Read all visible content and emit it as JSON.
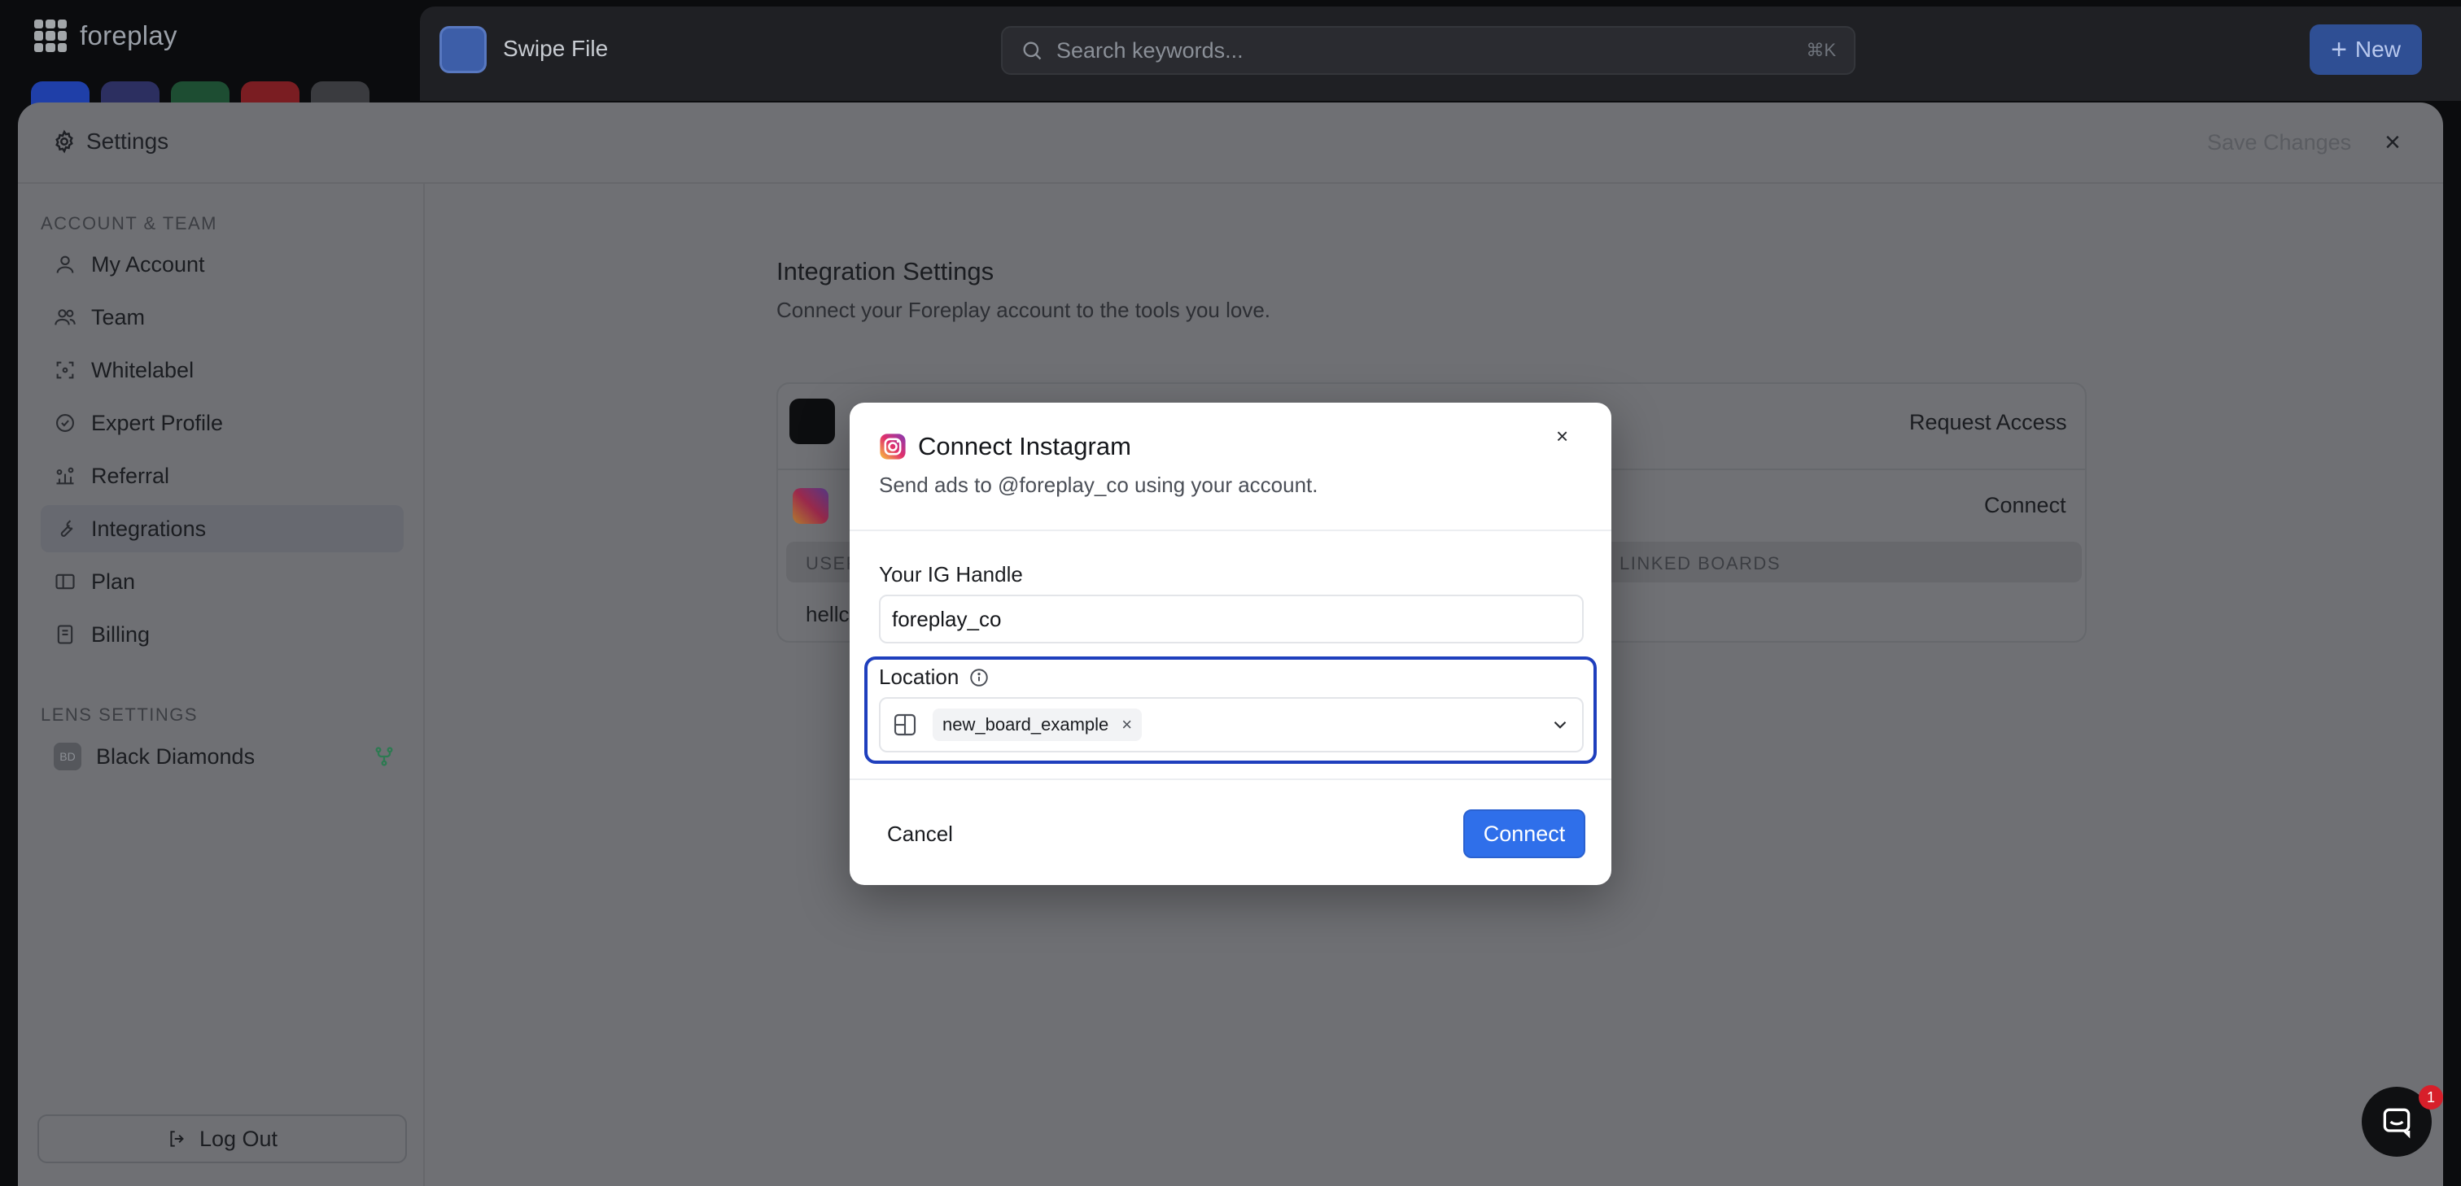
{
  "app": {
    "logo_text": "foreplay",
    "workspace_title": "Swipe File",
    "search_placeholder": "Search keywords...",
    "search_shortcut": "⌘K",
    "new_button": "New"
  },
  "settings": {
    "title": "Settings",
    "save_changes": "Save Changes",
    "close_glyph": "×",
    "sections": {
      "account_team": "ACCOUNT & TEAM",
      "lens_settings": "LENS SETTINGS"
    },
    "items": [
      {
        "label": "My Account",
        "icon": "user-icon"
      },
      {
        "label": "Team",
        "icon": "users-icon"
      },
      {
        "label": "Whitelabel",
        "icon": "whitelabel-icon"
      },
      {
        "label": "Expert Profile",
        "icon": "badge-icon"
      },
      {
        "label": "Referral",
        "icon": "referral-icon"
      },
      {
        "label": "Integrations",
        "icon": "wrench-icon"
      },
      {
        "label": "Plan",
        "icon": "plan-icon"
      },
      {
        "label": "Billing",
        "icon": "receipt-icon"
      }
    ],
    "active_item": "Integrations",
    "lens": {
      "badge": "BD",
      "label": "Black Diamonds"
    },
    "logout": "Log Out"
  },
  "integrations": {
    "title": "Integration Settings",
    "subtitle": "Connect your Foreplay account to the tools you love.",
    "request_access": "Request Access",
    "connect": "Connect",
    "col_users": "USEF",
    "col_linked_boards": "LINKED BOARDS",
    "row_user": "hellc"
  },
  "modal": {
    "title": "Connect Instagram",
    "subtitle": "Send ads to @foreplay_co using your account.",
    "handle_label": "Your IG Handle",
    "handle_value": "foreplay_co",
    "location_label": "Location",
    "selected_board": "new_board_example",
    "cancel": "Cancel",
    "connect": "Connect",
    "close_glyph": "×"
  },
  "chat": {
    "badge": "1"
  },
  "colors": {
    "accent": "#2f6fea",
    "focus_ring": "#1f3fbd",
    "instagram_gradient": [
      "#f9c53a",
      "#e1306c",
      "#833ab4"
    ],
    "badge_red": "#d71f2a"
  }
}
